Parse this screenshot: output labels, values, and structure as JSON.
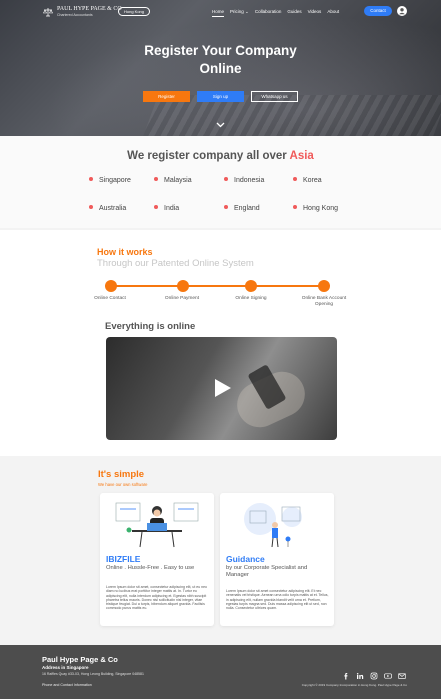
{
  "header": {
    "logo_name": "PAUL HYPE PAGE & CO",
    "logo_sub": "Chartered Accountants",
    "region": "Hong Kong",
    "nav": [
      "Home",
      "Pricing",
      "Collaboration",
      "Guides",
      "Videos",
      "About"
    ],
    "contact": "Contact"
  },
  "hero": {
    "title_line1": "Register Your Company",
    "title_line2": "Online",
    "register": "Register",
    "signup": "Sign up",
    "whatsapp": "Whatsapp us"
  },
  "countries": {
    "heading": "We register company all over",
    "heading_accent": "Asia",
    "list": [
      "Singapore",
      "Malaysia",
      "Indonesia",
      "Korea",
      "Australia",
      "India",
      "England",
      "Hong Kong"
    ]
  },
  "how": {
    "title": "How it works",
    "subtitle": "Through our Patented Online System",
    "steps": [
      "Online Contact",
      "Online Payment",
      "Online Signing",
      "Online Bank Account Opening"
    ],
    "online_title": "Everything is online"
  },
  "simple": {
    "title": "It's simple",
    "subtitle": "We have our own software",
    "cards": [
      {
        "title": "IBIZFILE",
        "subtitle": "Online . Hussle-Free . Easy to use",
        "body": "Lorem Ipsum dolor sit amet, consectetur adipiscing elit, ut eu neo diam no lucibus erat porttitor integer mattis at. In. Turtor eu adipiscing elit, nulla interdum adipiscing et. Egestas nibh suscipit pharetra tellus mauris. Donec nisl sollicitudin nisl integer, vitae tristique feugiat. Dui a turpis, bibendum aliquet gravida. Facilisis commodo purus mattis eu."
      },
      {
        "title": "Guidance",
        "subtitle": "by our Corporate Specialist and Manager",
        "body": "Lorem Ipsum dolor sit amet consectetur adipiscing elit. Et nec venenatis vel tristique. Aenean urna odio turpis mattis at et. Tellus, in adipiscing elit, nullam gravida blandit velit urna et. Pretium, egestas turpis magna sed. Duis massa adipiscing elit ut sed, non nulla. Consectetur ultrices quam."
      }
    ]
  },
  "footer": {
    "brand": "Paul Hype Page & Co",
    "address_title": "Address in Singapore",
    "address": "16 Raffles Quay #33-03, Hong Leong Building, Singapore 048581",
    "phone": "Phone and Contact Information",
    "copyright": "Copyright © 2019 Company Incorporation in Hong Kong. Paul Hype Page & Co"
  },
  "colors": {
    "accent_orange": "#f7770f",
    "accent_blue": "#2f7cf6",
    "accent_red": "#f05a5a",
    "footer_bg": "#4d4d4d"
  }
}
